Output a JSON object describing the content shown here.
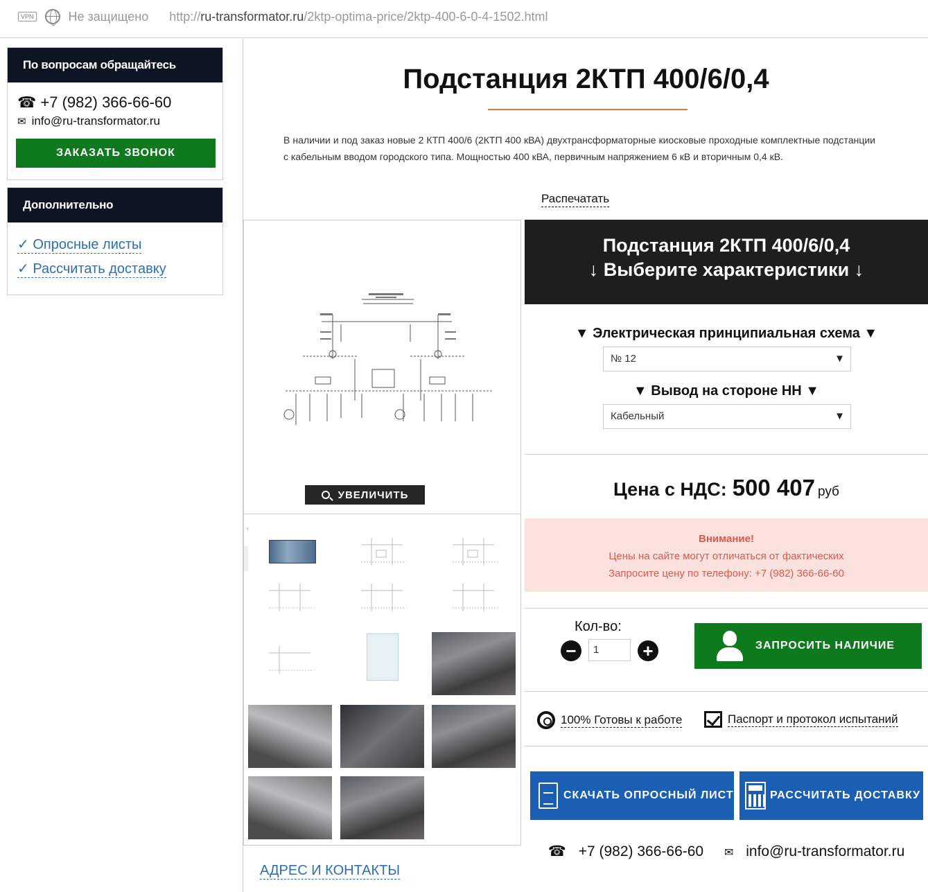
{
  "browser": {
    "vpn_badge": "VPN",
    "security": "Не защищено",
    "url_prefix": "http://",
    "url_host": "ru-transformator.ru",
    "url_path": "/2ktp-optima-price/2ktp-400-6-0-4-1502.html"
  },
  "sidebar": {
    "contact_title": "По вопросам обращайтесь",
    "phone": "+7 (982) 366-66-60",
    "email": "info@ru-transformator.ru",
    "call_button": "ЗАКАЗАТЬ ЗВОНОК",
    "extra_title": "Дополнительно",
    "links": [
      "✓ Опросные листы",
      "✓ Рассчитать доставку"
    ]
  },
  "product": {
    "title": "Подстанция 2КТП 400/6/0,4",
    "description": "В наличии и под заказ новые 2 КТП 400/6 (2КТП 400 кВА) двухтрансформаторные киосковые проходные комплектные подстанции с кабельным вводом городского типа. Мощностью 400 кВА, первичным напряжением 6 кВ и вторичным 0,4 кВ.",
    "print_link": "Распечатать"
  },
  "gallery": {
    "zoom_button": "УВЕЛИЧИТЬ",
    "prev": "‹",
    "next": "›"
  },
  "panel": {
    "header_line1": "Подстанция 2КТП 400/6/0,4",
    "header_line2": "↓ Выберите характеристики ↓",
    "option1_label": "▼ Электрическая принципиальная схема ▼",
    "option1_value": "№ 12",
    "option2_label": "▼ Вывод на стороне НН ▼",
    "option2_value": "Кабельный",
    "price_label": "Цена с НДС:",
    "price_value": "500 407",
    "price_currency": "руб",
    "warning_title": "Внимание!",
    "warning_line1": "Цены на сайте могут отличаться от фактических",
    "warning_line2": "Запросите цену по телефону: +7 (982) 366-66-60",
    "qty_label": "Кол-во:",
    "qty_value": "1",
    "qty_minus": "−",
    "qty_plus": "+",
    "request_button": "ЗАПРОСИТЬ НАЛИЧИЕ",
    "feature1": "100% Готовы к работе",
    "feature2": "Паспорт и протокол испытаний",
    "download_button": "СКАЧАТЬ ОПРОСНЫЙ ЛИСТ",
    "delivery_button": "РАССЧИТАТЬ ДОСТАВКУ",
    "footer_phone": "+7 (982) 366-66-60",
    "footer_email": "info@ru-transformator.ru"
  },
  "address_link": "АДРЕС И КОНТАКТЫ",
  "colors": {
    "dark_header": "#0d1525",
    "green": "#0e7a1d",
    "blue": "#1a5fb4",
    "accent_line": "#e07b3c",
    "warning_bg": "#fbe2de",
    "warning_text": "#e0584a",
    "link": "#2a6fb5"
  }
}
